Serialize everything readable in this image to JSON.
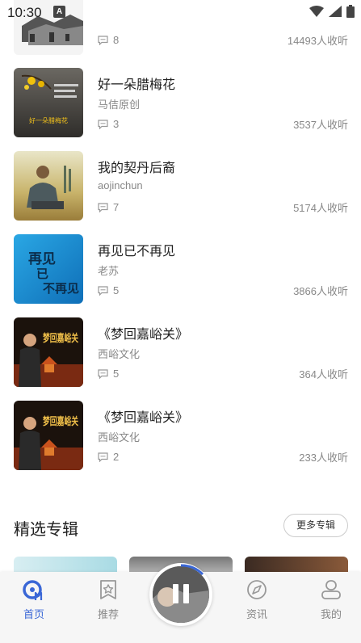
{
  "status": {
    "time": "10:30",
    "a_badge": "A"
  },
  "feed": {
    "first_row": {
      "comments": "8",
      "plays": "14493人收听"
    },
    "rows": [
      {
        "title": "好一朵腊梅花",
        "author": "马佶原创",
        "comments": "3",
        "plays": "3537人收听"
      },
      {
        "title": "我的契丹后裔",
        "author": "aojinchun",
        "comments": "7",
        "plays": "5174人收听"
      },
      {
        "title": "再见已不再见",
        "author": "老苏",
        "comments": "5",
        "plays": "3866人收听"
      },
      {
        "title": "《梦回嘉峪关》",
        "author": "西峪文化",
        "comments": "5",
        "plays": "364人收听"
      },
      {
        "title": "《梦回嘉峪关》",
        "author": "西峪文化",
        "comments": "2",
        "plays": "233人收听"
      }
    ]
  },
  "thumb_text": {
    "plum": "好一朵腊梅花",
    "farewell": [
      "再见",
      "已",
      "不再见"
    ],
    "mengui": "梦回嘉峪关"
  },
  "section": {
    "title": "精选专辑",
    "more_label": "更多专辑"
  },
  "tabbar": {
    "tabs": [
      {
        "label": "首页"
      },
      {
        "label": "推荐"
      },
      {
        "label": "资讯"
      },
      {
        "label": "我的"
      }
    ],
    "active_color": "#3a67d6"
  }
}
